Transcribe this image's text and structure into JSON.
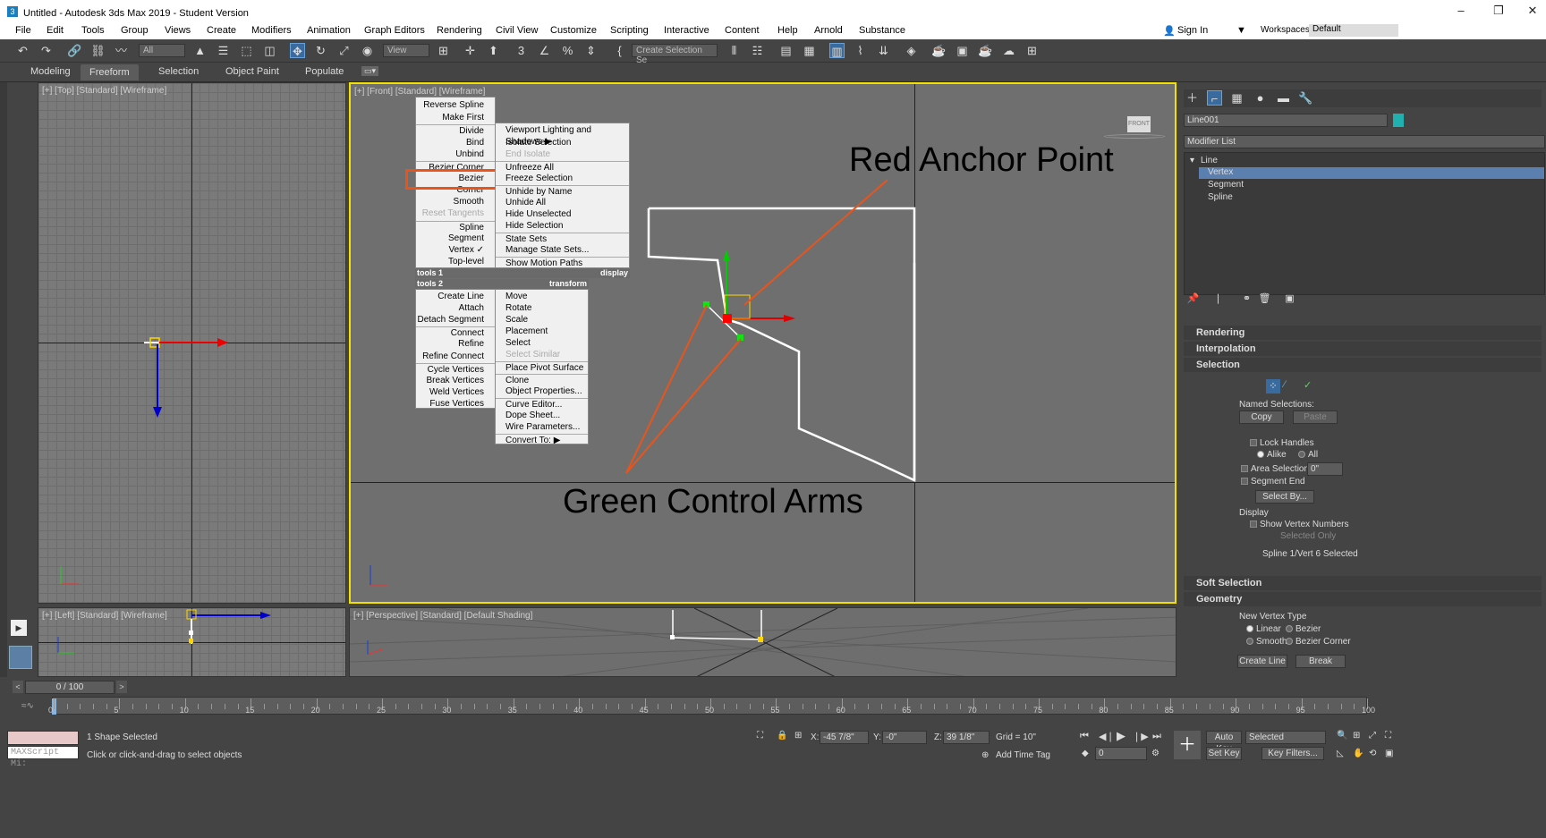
{
  "window": {
    "title": "Untitled - Autodesk 3ds Max 2019 - Student Version",
    "app_icon": "3",
    "min": "–",
    "restore": "❐",
    "close": "✕"
  },
  "menu": [
    "File",
    "Edit",
    "Tools",
    "Group",
    "Views",
    "Create",
    "Modifiers",
    "Animation",
    "Graph Editors",
    "Rendering",
    "Civil View",
    "Customize",
    "Scripting",
    "Interactive",
    "Content",
    "Help",
    "Arnold",
    "Substance"
  ],
  "account": {
    "sign_in": "Sign In",
    "workspaces_label": "Workspaces:",
    "workspace": "Default"
  },
  "toolbar": {
    "filter": "All",
    "ref_coord": "View",
    "named_sel": "Create Selection Se"
  },
  "ribbon_tabs": [
    "Modeling",
    "Freeform",
    "Selection",
    "Object Paint",
    "Populate"
  ],
  "viewports": {
    "top": "[+] [Top] [Standard] [Wireframe]",
    "front": "[+] [Front] [Standard] [Wireframe]",
    "left": "[+] [Left] [Standard] [Wireframe]",
    "perspective": "[+] [Perspective] [Standard] [Default Shading]",
    "viewcube": "FRONT"
  },
  "quad_left": [
    {
      "label": "Reverse Spline"
    },
    {
      "label": "Make First"
    },
    {
      "label": "Divide",
      "sep": true
    },
    {
      "label": "Bind"
    },
    {
      "label": "Unbind"
    },
    {
      "label": "Bezier Corner",
      "sep": true
    },
    {
      "label": "Bezier"
    },
    {
      "label": "Corner"
    },
    {
      "label": "Smooth"
    },
    {
      "label": "Reset Tangents",
      "dim": true
    },
    {
      "label": "Spline",
      "sep": true
    },
    {
      "label": "Segment"
    },
    {
      "label": "Vertex ✓"
    },
    {
      "label": "Top-level"
    }
  ],
  "quad_left_lower": [
    {
      "label": "Create Line"
    },
    {
      "label": "Attach"
    },
    {
      "label": "Detach Segment"
    },
    {
      "label": "Connect",
      "sep": true
    },
    {
      "label": "Refine"
    },
    {
      "label": "Refine Connect"
    },
    {
      "label": "Cycle Vertices",
      "sep": true
    },
    {
      "label": "Break Vertices"
    },
    {
      "label": "Weld Vertices"
    },
    {
      "label": "Fuse Vertices"
    }
  ],
  "quad_right": [
    {
      "label": "Viewport Lighting and Shadows ▶"
    },
    {
      "label": "Isolate Selection"
    },
    {
      "label": "End Isolate",
      "dim": true
    },
    {
      "label": "Unfreeze All",
      "sep": true
    },
    {
      "label": "Freeze Selection"
    },
    {
      "label": "Unhide by Name",
      "sep": true
    },
    {
      "label": "Unhide All"
    },
    {
      "label": "Hide Unselected"
    },
    {
      "label": "Hide Selection"
    },
    {
      "label": "State Sets",
      "sep": true
    },
    {
      "label": "Manage State Sets..."
    },
    {
      "label": "Show Motion Paths",
      "sep": true
    }
  ],
  "quad_right_lower": [
    {
      "label": "Move"
    },
    {
      "label": "Rotate"
    },
    {
      "label": "Scale"
    },
    {
      "label": "Placement"
    },
    {
      "label": "Select"
    },
    {
      "label": "Select Similar",
      "dim": true
    },
    {
      "label": "Place Pivot Surface",
      "sep": true
    },
    {
      "label": "Clone",
      "sep": true
    },
    {
      "label": "Object Properties..."
    },
    {
      "label": "Curve Editor...",
      "sep": true
    },
    {
      "label": "Dope Sheet..."
    },
    {
      "label": "Wire Parameters..."
    },
    {
      "label": "Convert To: ▶",
      "sep": true
    }
  ],
  "quad_headers": {
    "tools1": "tools 1",
    "display": "display",
    "tools2": "tools 2",
    "transform": "transform"
  },
  "annotations": {
    "red": "Red Anchor Point",
    "green": "Green Control Arms"
  },
  "command_panel": {
    "object_name": "Line001",
    "modifier_list": "Modifier List",
    "stack": [
      "Line",
      "Vertex",
      "Segment",
      "Spline"
    ],
    "rollouts": {
      "rendering": "Rendering",
      "interpolation": "Interpolation",
      "selection": "Selection",
      "soft": "Soft Selection",
      "geometry": "Geometry"
    },
    "named_selections": "Named Selections:",
    "copy": "Copy",
    "paste": "Paste",
    "lock_handles": "Lock Handles",
    "alike": "Alike",
    "all": "All",
    "area_selection": "Area Selection:",
    "area_value": "0\"",
    "segment_end": "Segment End",
    "select_by": "Select By...",
    "display": "Display",
    "show_vertex_numbers": "Show Vertex Numbers",
    "selected_only": "Selected Only",
    "sel_status": "Spline 1/Vert 6 Selected",
    "new_vertex_type": "New Vertex Type",
    "linear": "Linear",
    "bezier": "Bezier",
    "smooth": "Smooth",
    "bezier_corner": "Bezier Corner",
    "create_line": "Create Line",
    "break": "Break"
  },
  "timeline": {
    "frame": "0 / 100",
    "ticks": [
      "0",
      "5",
      "10",
      "15",
      "20",
      "25",
      "30",
      "35",
      "40",
      "45",
      "50",
      "55",
      "60",
      "65",
      "70",
      "75",
      "80",
      "85",
      "90",
      "95",
      "100"
    ]
  },
  "status": {
    "maxscript": "MAXScript Mi:",
    "selected": "1 Shape Selected",
    "prompt": "Click or click-and-drag to select objects",
    "x_label": "X:",
    "x": "-45 7/8\"",
    "y_label": "Y:",
    "y": "-0\"",
    "z_label": "Z:",
    "z": "39 1/8\"",
    "grid": "Grid = 10\"",
    "add_time_tag": "Add Time Tag",
    "auto_key": "Auto Key",
    "set_key": "Set Key",
    "selected_dd": "Selected",
    "key_filters": "Key Filters...",
    "frame_field": "0"
  }
}
